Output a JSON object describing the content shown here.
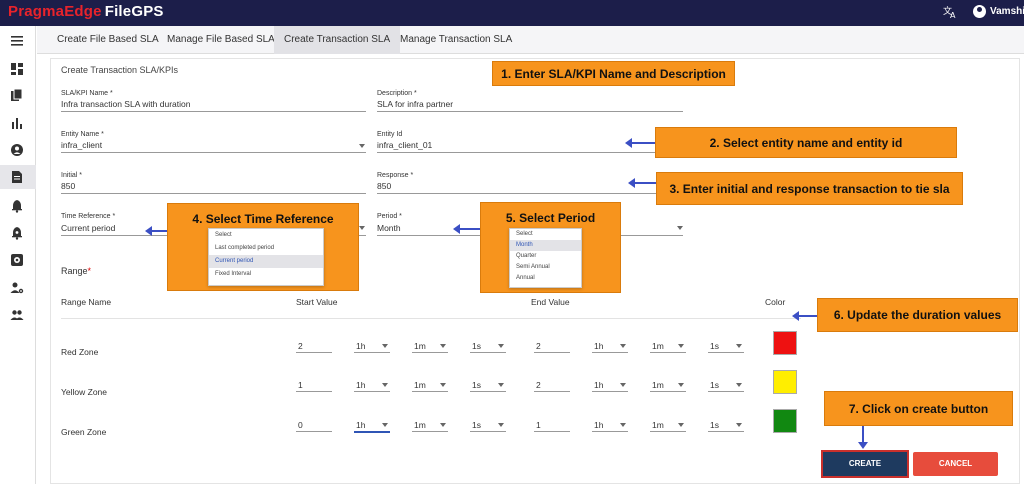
{
  "app": {
    "brand": "PragmaEdge",
    "product": "FileGPS",
    "user": "Vamshi"
  },
  "tabs": [
    {
      "label": "Create File Based SLA"
    },
    {
      "label": "Manage File Based SLA"
    },
    {
      "label": "Create Transaction SLA"
    },
    {
      "label": "Manage Transaction SLA"
    }
  ],
  "form": {
    "title": "Create Transaction SLA/KPIs",
    "sla_name": {
      "label": "SLA/KPI Name *",
      "value": "Infra transaction SLA with duration"
    },
    "description": {
      "label": "Description *",
      "value": "SLA for infra partner"
    },
    "entity_name": {
      "label": "Entity Name *",
      "value": "infra_client"
    },
    "entity_id": {
      "label": "Entity Id",
      "value": "infra_client_01"
    },
    "initial": {
      "label": "Initial *",
      "value": "850"
    },
    "response": {
      "label": "Response *",
      "value": "850"
    },
    "time_reference": {
      "label": "Time Reference *",
      "value": "Current period"
    },
    "period": {
      "label": "Period *",
      "value": "Month"
    }
  },
  "time_ref_options": [
    "Select",
    "Last completed period",
    "Current period",
    "Fixed Interval"
  ],
  "period_options": [
    "Select",
    "Month",
    "Quarter",
    "Semi Annual",
    "Annual"
  ],
  "range": {
    "label": "Range",
    "required_mark": "*",
    "headers": {
      "name": "Range Name",
      "start": "Start Value",
      "end": "End Value",
      "color": "Color"
    },
    "rows": [
      {
        "name": "Red Zone",
        "start": "2",
        "end": "2",
        "color": "#ee1111"
      },
      {
        "name": "Yellow Zone",
        "start": "1",
        "end": "2",
        "color": "#ffee00"
      },
      {
        "name": "Green Zone",
        "start": "0",
        "end": "1",
        "color": "#118811"
      }
    ],
    "units": {
      "h": "1h",
      "m": "1m",
      "s": "1s"
    }
  },
  "buttons": {
    "create": "CREATE",
    "cancel": "CANCEL"
  },
  "callouts": [
    "1. Enter SLA/KPI Name and Description",
    "2. Select entity name and entity id",
    "3. Enter initial and response transaction to tie sla",
    "4. Select Time Reference",
    "5. Select Period",
    "6. Update the duration values",
    "7. Click on create button"
  ],
  "icons": {
    "menu": "hamburger-icon",
    "dashboard": "dashboard-icon",
    "files": "files-icon",
    "analytics": "bar-chart-icon",
    "account": "account-circle-icon",
    "sla": "document-icon",
    "alerts": "bell-icon",
    "alerts_settings": "bell-settings-icon",
    "settings": "gear-box-icon",
    "user_settings": "user-settings-icon",
    "users": "group-icon"
  },
  "colors": {
    "topbar": "#1c1e4a",
    "brand": "#e8232b",
    "callout": "#f7941d",
    "arrow": "#3b4fc4",
    "create": "#1e3a5f",
    "cancel": "#e74c3c"
  }
}
